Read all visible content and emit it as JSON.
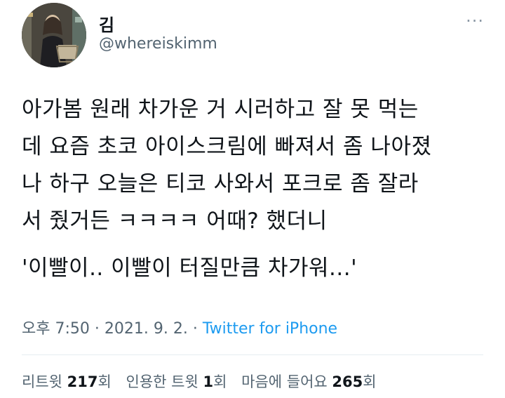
{
  "author": {
    "display_name": "김",
    "handle": "@whereiskimm"
  },
  "more_icon": "more-horizontal-icon",
  "tweet": {
    "lines": [
      "아가봄 원래 차가운 거 시러하고 잘 못 먹는",
      "데 요즘 초코 아이스크림에 빠져서 좀 나아졌",
      "나 하구 오늘은 티코 사와서 포크로 좀 잘라",
      "서 줬거든 ㅋㅋㅋㅋ 어때? 했더니"
    ],
    "quote": "'이빨이.. 이빨이 터질만큼 차가워...'"
  },
  "meta": {
    "time": "오후 7:50",
    "sep1": "·",
    "date": "2021. 9. 2.",
    "sep2": "·",
    "source": "Twitter for iPhone"
  },
  "stats": {
    "retweets_label": "리트윗",
    "retweets_count": "217",
    "retweets_unit": "회",
    "quotes_label": "인용한 트윗",
    "quotes_count": "1",
    "quotes_unit": "회",
    "likes_label": "마음에 들어요",
    "likes_count": "265",
    "likes_unit": "회"
  },
  "colors": {
    "text": "#0f1419",
    "secondary": "#536471",
    "link": "#1d9bf0",
    "divider": "#e6ecf0"
  }
}
